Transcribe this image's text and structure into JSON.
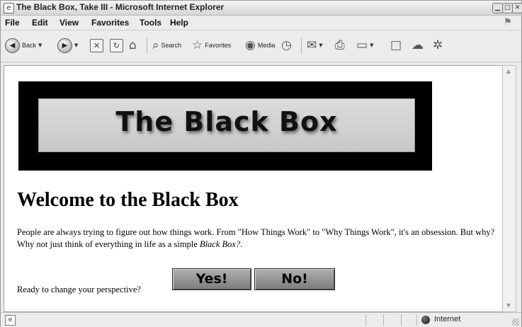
{
  "window": {
    "title": "The Black Box, Take III - Microsoft Internet Explorer",
    "controls": {
      "minimize": "▁",
      "maximize": "□",
      "close": "✕"
    }
  },
  "menu": {
    "items": [
      "File",
      "Edit",
      "View",
      "Favorites",
      "Tools",
      "Help"
    ]
  },
  "toolbar": {
    "back_label": "Back",
    "search_label": "Search",
    "favorites_label": "Favorites",
    "media_label": "Media"
  },
  "page": {
    "banner_text": "The Black Box",
    "heading": "Welcome to the Black Box",
    "paragraph_main": "People are always trying to figure out how things work. From \"How Things Work\" to \"Why Things Work\", it's an obsession. But why? Why not just think of everything in life as a simple ",
    "paragraph_em": "Black Box?",
    "paragraph_end": ".",
    "prompt": "Ready to change your perspective?",
    "yes_button": "Yes!",
    "no_button": "No!"
  },
  "status": {
    "zone": "Internet"
  },
  "icons": [
    "ie-page-icon",
    "back-icon",
    "forward-icon",
    "stop-icon",
    "refresh-icon",
    "home-icon",
    "search-icon",
    "favorites-star-icon",
    "media-icon",
    "history-icon",
    "mail-icon",
    "print-icon",
    "edit-icon",
    "discuss-icon",
    "messenger-icon",
    "globe-icon"
  ]
}
